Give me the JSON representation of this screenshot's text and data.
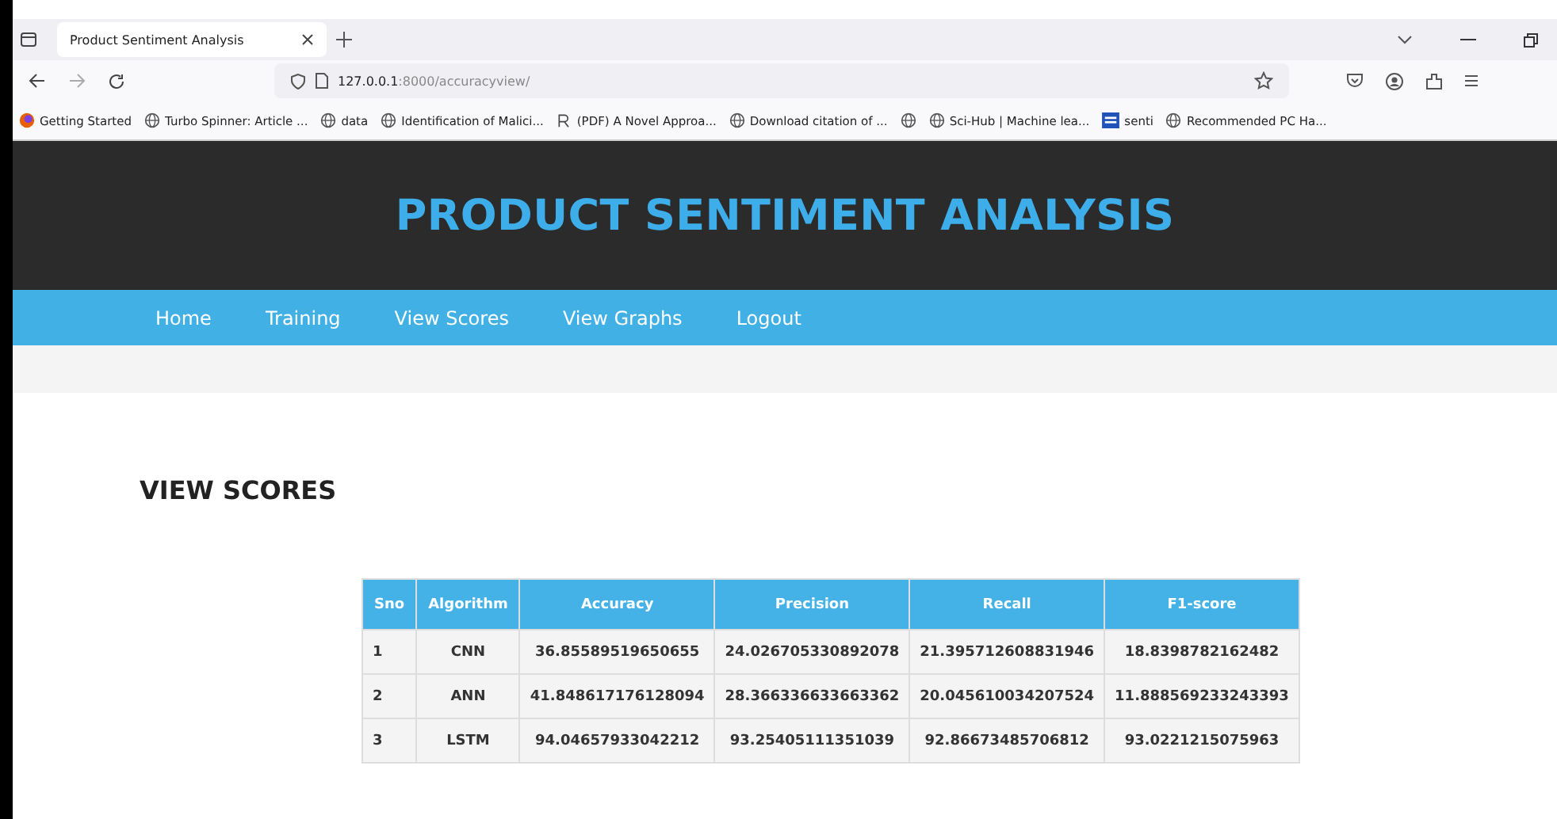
{
  "browser": {
    "tab_title": "Product Sentiment Analysis",
    "url_host": "127.0.0.1",
    "url_rest": ":8000/accuracyview/",
    "bookmarks": [
      {
        "label": "Getting Started",
        "kind": "fox"
      },
      {
        "label": "Turbo Spinner: Article ...",
        "kind": "globe"
      },
      {
        "label": "data",
        "kind": "globe"
      },
      {
        "label": "Identification of Malici...",
        "kind": "globe"
      },
      {
        "label": "(PDF) A Novel Approa...",
        "kind": "rg"
      },
      {
        "label": "Download citation of ...",
        "kind": "globe"
      },
      {
        "kind": "globe"
      },
      {
        "label": "Sci-Hub | Machine lea...",
        "kind": "globe"
      },
      {
        "label": "senti",
        "kind": "tile"
      },
      {
        "label": "Recommended PC Ha...",
        "kind": "globe"
      }
    ]
  },
  "header": {
    "title": "PRODUCT SENTIMENT ANALYSIS"
  },
  "nav": [
    "Home",
    "Training",
    "View Scores",
    "View Graphs",
    "Logout"
  ],
  "section_title": "VIEW SCORES",
  "table": {
    "columns": [
      "Sno",
      "Algorithm",
      "Accuracy",
      "Precision",
      "Recall",
      "F1-score"
    ],
    "rows": [
      [
        "1",
        "CNN",
        "36.85589519650655",
        "24.026705330892078",
        "21.395712608831946",
        "18.8398782162482"
      ],
      [
        "2",
        "ANN",
        "41.848617176128094",
        "28.366336633663362",
        "20.045610034207524",
        "11.888569233243393"
      ],
      [
        "3",
        "LSTM",
        "94.04657933042212",
        "93.25405111351039",
        "92.86673485706812",
        "93.0221215075963"
      ]
    ]
  }
}
